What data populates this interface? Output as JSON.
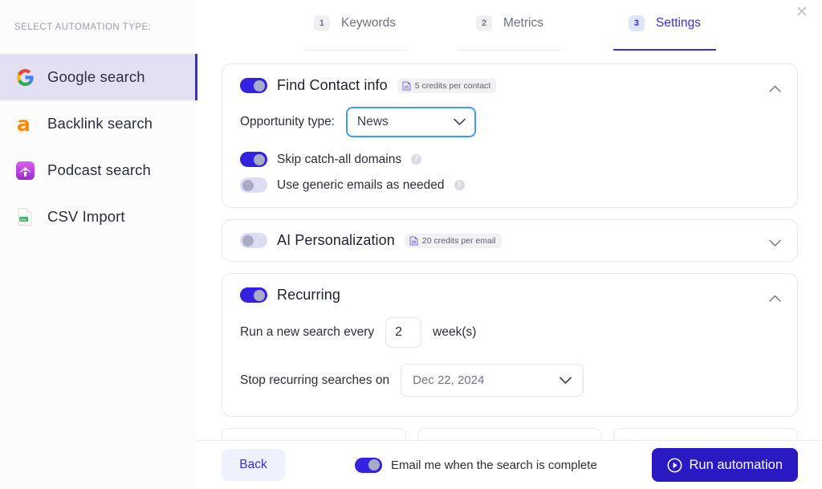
{
  "sidebar": {
    "title": "SELECT AUTOMATION TYPE:",
    "items": [
      {
        "label": "Google search",
        "icon": "google-icon",
        "active": true
      },
      {
        "label": "Backlink search",
        "icon": "ahrefs-icon",
        "active": false
      },
      {
        "label": "Podcast search",
        "icon": "podcast-icon",
        "active": false
      },
      {
        "label": "CSV Import",
        "icon": "csv-file-icon",
        "active": false
      }
    ]
  },
  "close_label": "✕",
  "stepper": {
    "steps": [
      {
        "number": "1",
        "label": "Keywords",
        "active": false
      },
      {
        "number": "2",
        "label": "Metrics",
        "active": false
      },
      {
        "number": "3",
        "label": "Settings",
        "active": true
      }
    ]
  },
  "contact_card": {
    "title": "Find Contact info",
    "toggle_state": "on",
    "badge": "5 credits per contact",
    "chevron": "chevron-up",
    "opportunity_label": "Opportunity type:",
    "opportunity_value": "News",
    "options": [
      {
        "label": "Skip catch-all domains",
        "state": "on"
      },
      {
        "label": "Use generic emails as needed",
        "state": "off"
      }
    ]
  },
  "ai_card": {
    "title": "AI Personalization",
    "toggle_state": "off",
    "badge": "20 credits per email",
    "chevron": "chevron-down"
  },
  "recurring_card": {
    "title": "Recurring",
    "toggle_state": "on",
    "chevron": "chevron-up",
    "every_prefix": "Run a new search every",
    "every_value": "2",
    "every_suffix": "week(s)",
    "stop_label": "Stop recurring searches on",
    "stop_value": "Dec 22, 2024"
  },
  "footer": {
    "back_label": "Back",
    "email_toggle_state": "on",
    "email_label": "Email me when the search is complete",
    "run_label": "Run automation"
  },
  "colors": {
    "accent": "#3e30d8",
    "toggle_on": "#3322e0",
    "toggle_off": "#dcdcf3",
    "run_button": "#2a1ac4",
    "sidebar_active_bg": "#e2e0f2",
    "focus_ring": "#3d9bf5"
  }
}
